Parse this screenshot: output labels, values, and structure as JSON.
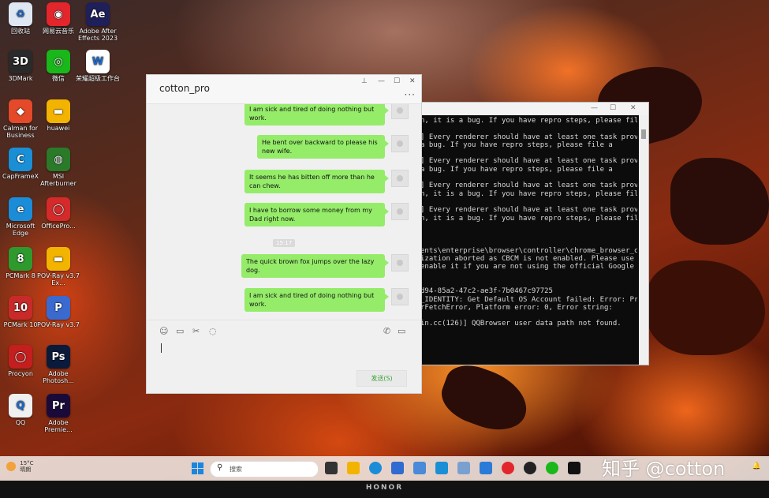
{
  "desktop_icons": [
    {
      "label": "回收站",
      "icon": "recycle-bin-icon",
      "color": "#dfe8f2"
    },
    {
      "label": "网易云音乐",
      "icon": "netease-music-icon",
      "color": "#e3262c"
    },
    {
      "label": "Adobe After Effects 2023",
      "icon": "after-effects-icon",
      "color": "#1f1f5a"
    },
    {
      "label": "3DMark",
      "icon": "3dmark-icon",
      "color": "#2a2a2a"
    },
    {
      "label": "微信",
      "icon": "wechat-icon",
      "color": "#19b719"
    },
    {
      "label": "荣耀超级工作台",
      "icon": "honor-workstation-icon",
      "color": "#ffffff"
    },
    {
      "label": "Calman for Business",
      "icon": "calman-icon",
      "color": "#e44a2a"
    },
    {
      "label": "huawei",
      "icon": "folder-icon",
      "color": "#f2b400"
    },
    {
      "label": "CapFrameX",
      "icon": "capframex-icon",
      "color": "#1a8fd6"
    },
    {
      "label": "MSI Afterburner",
      "icon": "msi-afterburner-icon",
      "color": "#2a7a2a"
    },
    {
      "label": "Microsoft Edge",
      "icon": "edge-icon",
      "color": "#1b8dd8"
    },
    {
      "label": "OfficePro...",
      "icon": "officepro-icon",
      "color": "#d42a2a"
    },
    {
      "label": "PCMark 8",
      "icon": "pcmark8-icon",
      "color": "#2e9a2e"
    },
    {
      "label": "POV-Ray v3.7 Ex...",
      "icon": "folder-icon",
      "color": "#f2b400"
    },
    {
      "label": "PCMark 10",
      "icon": "pcmark10-icon",
      "color": "#c82a2a"
    },
    {
      "label": "POV-Ray v3.7",
      "icon": "povray-icon",
      "color": "#3a6ad0"
    },
    {
      "label": "Procyon",
      "icon": "procyon-icon",
      "color": "#c41e1e"
    },
    {
      "label": "Adobe Photosh...",
      "icon": "photoshop-icon",
      "color": "#0a1a3a"
    },
    {
      "label": "QQ",
      "icon": "qq-icon",
      "color": "#f0f0f0"
    },
    {
      "label": "Adobe Premie...",
      "icon": "premiere-icon",
      "color": "#1a0a3a"
    }
  ],
  "console": {
    "lines": [
      "n, it is a bug. If you have repro steps, please file a",
      "",
      "] Every renderer should have at least one task provided",
      "a bug. If you have repro steps, please file a",
      "",
      "] Every renderer should have at least one task provided",
      "a bug. If you have repro steps, please file a",
      "",
      "] Every renderer should have at least one task provided",
      "n, it is a bug. If you have repro steps, please file a",
      "",
      "] Every renderer should have at least one task provided",
      "n, it is a bug. If you have repro steps, please file a",
      "",
      "",
      "",
      "ents\\enterprise\\browser\\controller\\chrome_browser_cloud",
      "ization aborted as CBCM is not enabled. Please use the",
      "enable it if you are not using the official Google Chro",
      "",
      "",
      "d94-85a2-47c2-ae3f-7b0467c97725",
      "_IDENTITY: Get Default OS Account failed: Error: Primar",
      "rFetchError, Platform error: 0, Error string:",
      "",
      "in.cc(126)] QQBrowser user data path not found."
    ]
  },
  "chat": {
    "title": "cotton_pro",
    "messages": [
      "I am sick and tired of doing nothing but work.",
      "He bent over backward to please his new wife.",
      "It seems he has bitten off more than he can chew.",
      "I have to borrow some money from my Dad right now.",
      "The quick brown fox jumps over the lazy dog.",
      "I am sick and tired of doing nothing but work."
    ],
    "timestamp": "15:17",
    "send_label": "发送(S)",
    "bubble_color": "#95ec69"
  },
  "taskbar": {
    "weather_temp": "15°C",
    "weather_desc": "晴朗",
    "search_placeholder": "搜索",
    "watermark": "知乎 @cotton"
  },
  "bezel": {
    "brand": "HONOR"
  }
}
